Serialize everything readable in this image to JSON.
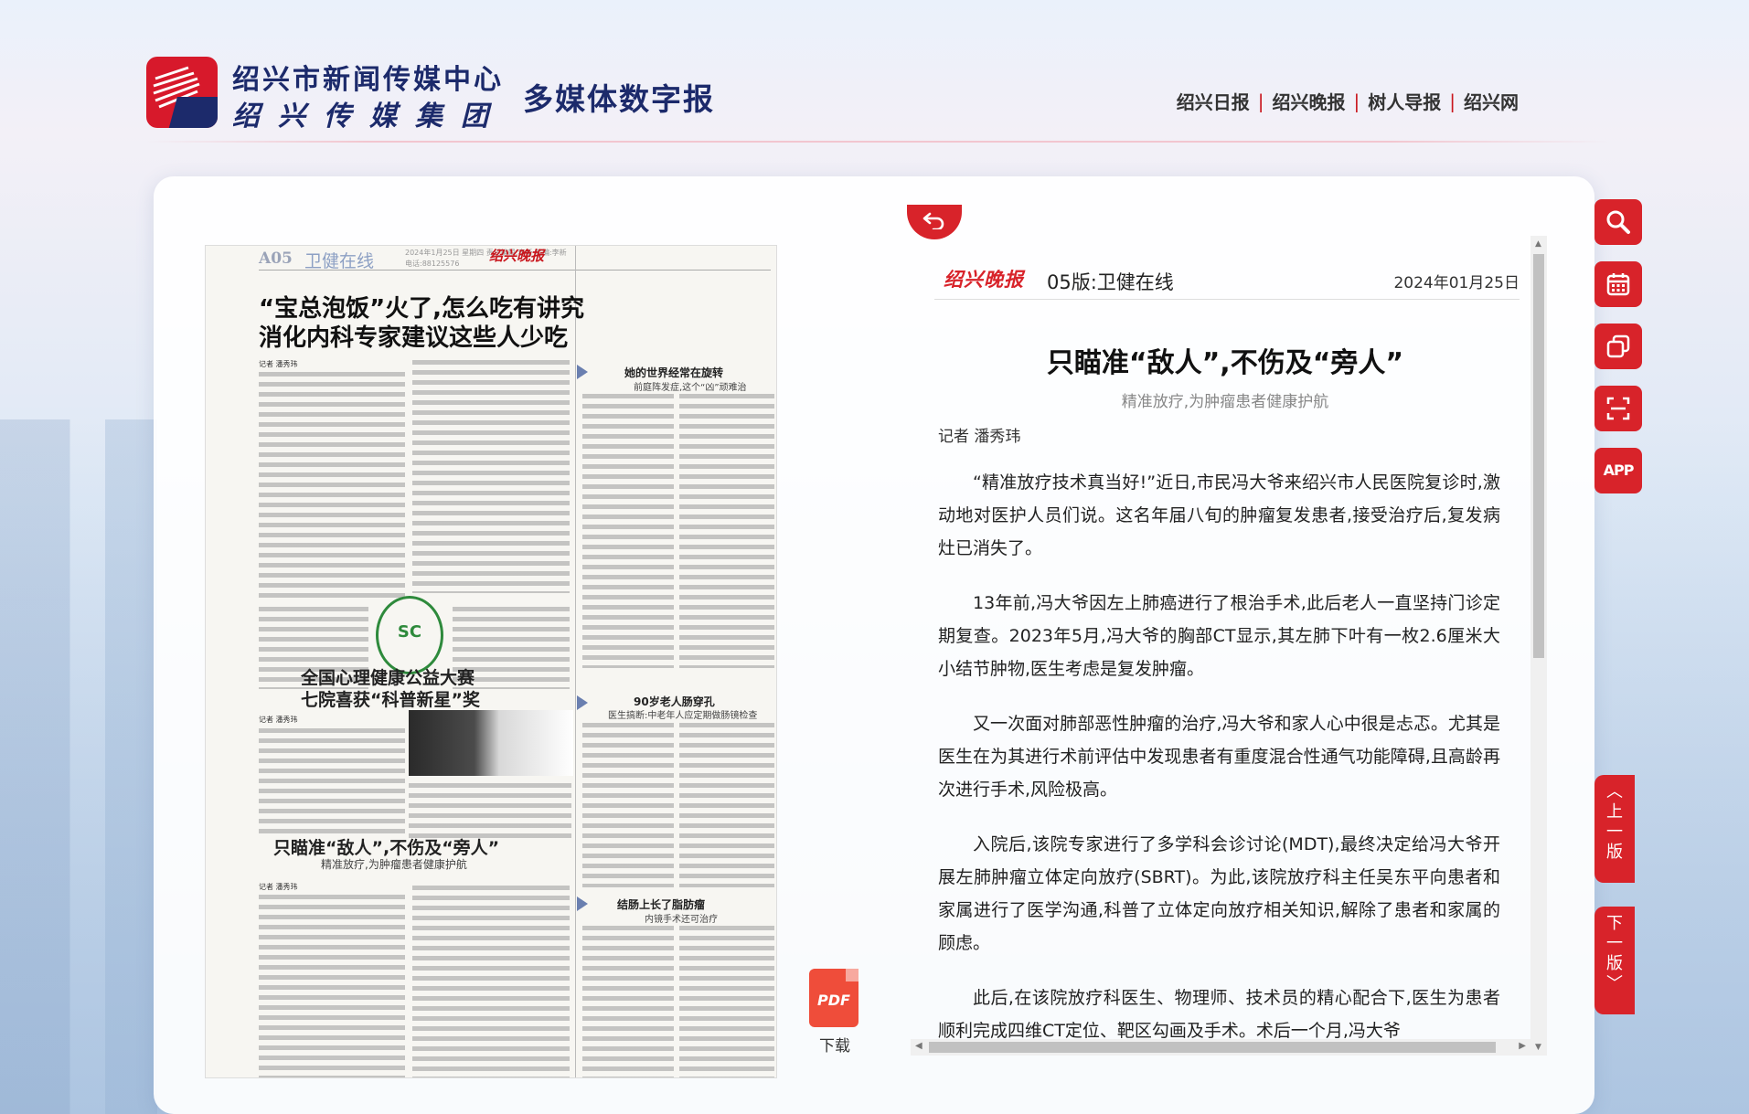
{
  "header": {
    "org_line1": "绍兴市新闻传媒中心",
    "org_line2": "绍兴传媒集团",
    "site_title": "多媒体数字报",
    "nav": [
      {
        "label": "绍兴日报"
      },
      {
        "label": "绍兴晚报"
      },
      {
        "label": "树人导报"
      },
      {
        "label": "绍兴网"
      }
    ],
    "separator": "|"
  },
  "paper": {
    "folio": "A05",
    "section": "卫健在线",
    "folio_meta": "2024年1月25日  星期四  责任编辑:李新 美编:李新 电话:88125576",
    "masthead": "绍兴晚报",
    "headline1_line1": "“宝总泡饭”火了,怎么吃有讲究",
    "headline1_line2": "消化内科专家建议这些人少吃",
    "byline1": "记者 潘秀玮",
    "side1_title": "她的世界经常在旋转",
    "side1_deck": "前庭阵发症,这个“凶”顽难治",
    "headline2_line1": "全国心理健康公益大赛",
    "headline2_line2": "七院喜获“科普新星”奖",
    "byline2": "记者 潘秀玮",
    "side2_title": "90岁老人肠穿孔",
    "side2_deck": "医生搞断:中老年人应定期做肠镜检查",
    "headline3": "只瞄准“敌人”,不伤及“旁人”",
    "headline3_deck": "精准放疗,为肿瘤患者健康护航",
    "byline3": "记者 潘秀玮",
    "side3_title": "结肠上长了脂肪瘤",
    "side3_deck": "内镜手术还可治疗",
    "seal_text": "SC"
  },
  "download": {
    "icon_text": "PDF",
    "label": "下载"
  },
  "article": {
    "masthead": "绍兴晚报",
    "edition": "05版:卫健在线",
    "date": "2024年01月25日",
    "title": "只瞄准“敌人”,不伤及“旁人”",
    "subtitle": "精准放疗,为肿瘤患者健康护航",
    "author": "记者 潘秀玮",
    "paragraphs": [
      "“精准放疗技术真当好!”近日,市民冯大爷来绍兴市人民医院复诊时,激动地对医护人员们说。这名年届八旬的肿瘤复发患者,接受治疗后,复发病灶已消失了。",
      "13年前,冯大爷因左上肺癌进行了根治手术,此后老人一直坚持门诊定期复查。2023年5月,冯大爷的胸部CT显示,其左肺下叶有一枚2.6厘米大小结节肿物,医生考虑是复发肿瘤。",
      "又一次面对肺部恶性肿瘤的治疗,冯大爷和家人心中很是忐忑。尤其是医生在为其进行术前评估中发现患者有重度混合性通气功能障碍,且高龄再次进行手术,风险极高。",
      "入院后,该院专家进行了多学科会诊讨论(MDT),最终决定给冯大爷开展左肺肿瘤立体定向放疗(SBRT)。为此,该院放疗科主任吴东平向患者和家属进行了医学沟通,科普了立体定向放疗相关知识,解除了患者和家属的顾虑。",
      "此后,在该院放疗科医生、物理师、技术员的精心配合下,医生为患者顺利完成四维CT定位、靶区勾画及手术。术后一个月,冯大爷"
    ]
  },
  "toolbar": {
    "app_label": "APP",
    "prev_page": "上一版",
    "next_page": "下一版",
    "icons": [
      "search-icon",
      "calendar-icon",
      "copy-icon",
      "scan-icon",
      "app-icon"
    ]
  },
  "colors": {
    "brand_red": "#d8232a",
    "brand_navy": "#1c2a6b"
  }
}
